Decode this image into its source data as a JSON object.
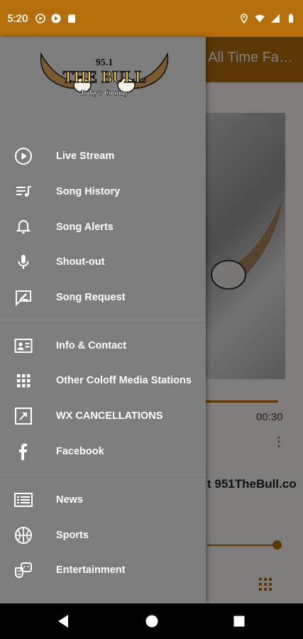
{
  "status_bar": {
    "time": "5:20",
    "left_icons": [
      "play-circle-icon",
      "google-play-icon",
      "sd-card-icon"
    ],
    "right_icons": [
      "location-icon",
      "wifi-icon",
      "signal-icon",
      "battery-icon"
    ]
  },
  "background": {
    "toolbar_title": "All Time Fa…",
    "time": "00:30",
    "text": "t 951TheBull.co"
  },
  "drawer": {
    "logo": {
      "number": "95.1",
      "name": "THE BULL",
      "tagline": "Today's Country"
    },
    "menu_items": [
      {
        "label": "Live Stream",
        "icon": "play-circle-icon"
      },
      {
        "label": "Song History",
        "icon": "playlist-icon"
      },
      {
        "label": "Song Alerts",
        "icon": "bell-icon"
      },
      {
        "label": "Shout-out",
        "icon": "microphone-icon"
      },
      {
        "label": "Song Request",
        "icon": "message-edit-icon"
      },
      {
        "label": "Info & Contact",
        "icon": "contact-card-icon"
      },
      {
        "label": "Other Coloff Media Stations",
        "icon": "grid-icon"
      },
      {
        "label": "WX CANCELLATIONS",
        "icon": "external-link-icon"
      },
      {
        "label": "Facebook",
        "icon": "facebook-icon"
      },
      {
        "label": "News",
        "icon": "news-icon"
      },
      {
        "label": "Sports",
        "icon": "basketball-icon"
      },
      {
        "label": "Entertainment",
        "icon": "theater-icon"
      }
    ]
  },
  "colors": {
    "accent": "#b46e0a",
    "drawer": "#7d7d7d"
  },
  "nav_bar": {
    "buttons": [
      "back-icon",
      "home-icon",
      "recents-icon"
    ]
  }
}
